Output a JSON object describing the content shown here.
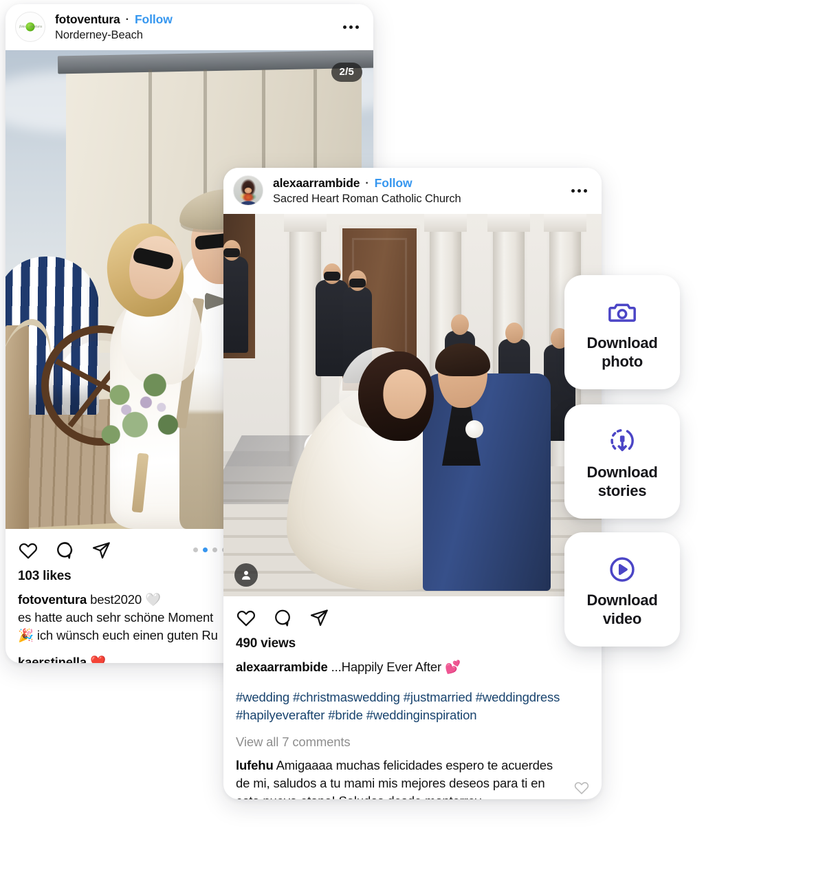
{
  "accent": {
    "purple": "#4B45C6",
    "instagram_blue": "#3797ef",
    "hashtag_blue": "#18436e",
    "muted_gray": "#8e8e8e",
    "carousel_active": "#3897f0"
  },
  "post_one": {
    "avatar_name": "fotoventura-avatar",
    "username": "fotoventura",
    "separator": "·",
    "follow_label": "Follow",
    "location": "Norderney-Beach",
    "more_label": "More options",
    "carousel_badge": "2/5",
    "carousel_total": 5,
    "carousel_active_index": 1,
    "likes": "103 likes",
    "caption_user": "fotoventura",
    "caption_line_1": "best2020 🤍",
    "caption_line_2": "es hatte auch sehr schöne Moment",
    "caption_line_3": "🎉 ich wünsch euch einen guten Ru",
    "second_user": "kaerstinella ❤️",
    "icons": {
      "like": "heart-icon",
      "comment": "comment-icon",
      "share": "share-icon"
    }
  },
  "post_two": {
    "avatar_name": "alexaarrambide-avatar",
    "username": "alexaarrambide",
    "separator": "·",
    "follow_label": "Follow",
    "location": "Sacred Heart Roman Catholic Church",
    "more_label": "More options",
    "tag_badge": "tagged-users-icon",
    "views": "490 views",
    "caption_user": "alexaarrambide",
    "caption_text": "...Happily Ever After 💕",
    "hashtags_line_1": "#wedding #christmaswedding #justmarried #weddingdress",
    "hashtags_line_2": "#hapilyeverafter #bride #weddinginspiration",
    "view_comments": "View all 7 comments",
    "comment_user": "lufehu",
    "comment_body": "Amigaaaa muchas felicidades espero te acuerdes de mi, saludos a tu mami mis mejores deseos para ti en esta nueva etapa! Saludos desde monterrey",
    "icons": {
      "like": "heart-icon",
      "comment": "comment-icon",
      "share": "share-icon",
      "comment_like": "heart-outline-icon"
    }
  },
  "download_buttons": [
    {
      "id": "photo",
      "icon": "camera-icon",
      "label_line_1": "Download",
      "label_line_2": "photo"
    },
    {
      "id": "stories",
      "icon": "story-download-icon",
      "label_line_1": "Download",
      "label_line_2": "stories"
    },
    {
      "id": "video",
      "icon": "play-circle-icon",
      "label_line_1": "Download",
      "label_line_2": "video"
    }
  ]
}
